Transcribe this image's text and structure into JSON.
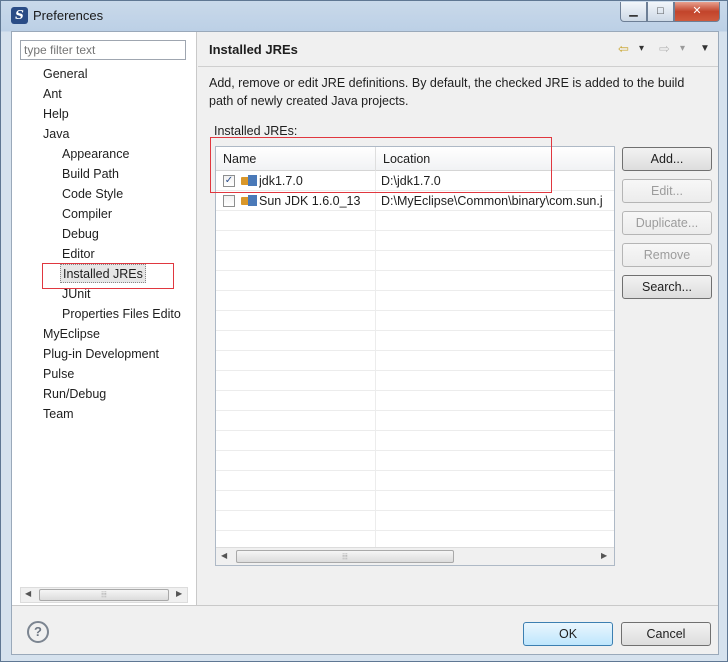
{
  "window": {
    "title": "Preferences",
    "minimize": "▁",
    "maximize": "□",
    "close": "✕"
  },
  "filter": {
    "placeholder": "type filter text"
  },
  "tree": {
    "general": "General",
    "ant": "Ant",
    "help": "Help",
    "java": "Java",
    "java_children": [
      "Appearance",
      "Build Path",
      "Code Style",
      "Compiler",
      "Debug",
      "Editor",
      "Installed JREs",
      "JUnit",
      "Properties Files Edito"
    ],
    "myeclipse": "MyEclipse",
    "plugin_dev": "Plug-in Development",
    "pulse": "Pulse",
    "run_debug": "Run/Debug",
    "team": "Team"
  },
  "page": {
    "title": "Installed JREs",
    "description": "Add, remove or edit JRE definitions. By default, the checked JRE is added to the build path of newly created Java projects.",
    "group_label": "Installed JREs:"
  },
  "table": {
    "columns": [
      "Name",
      "Location"
    ],
    "rows": [
      {
        "name": "jdk1.7.0",
        "location": "D:\\jdk1.7.0",
        "checked": true
      },
      {
        "name": "Sun JDK 1.6.0_13",
        "location": "D:\\MyEclipse\\Common\\binary\\com.sun.j",
        "checked": false
      }
    ]
  },
  "buttons": {
    "add": "Add...",
    "edit": "Edit...",
    "duplicate": "Duplicate...",
    "remove": "Remove",
    "search": "Search...",
    "ok": "OK",
    "cancel": "Cancel"
  },
  "icons": {
    "help": "?",
    "check": "✓",
    "back": "⇦",
    "forward": "⇨",
    "dropdown": "▾",
    "view_menu": "▼",
    "scroll_left": "◀",
    "scroll_right": "▶",
    "grip": "⦙⦙⦙"
  },
  "colors": {
    "highlight": "#e0373f",
    "accent": "#3c7fb1"
  }
}
